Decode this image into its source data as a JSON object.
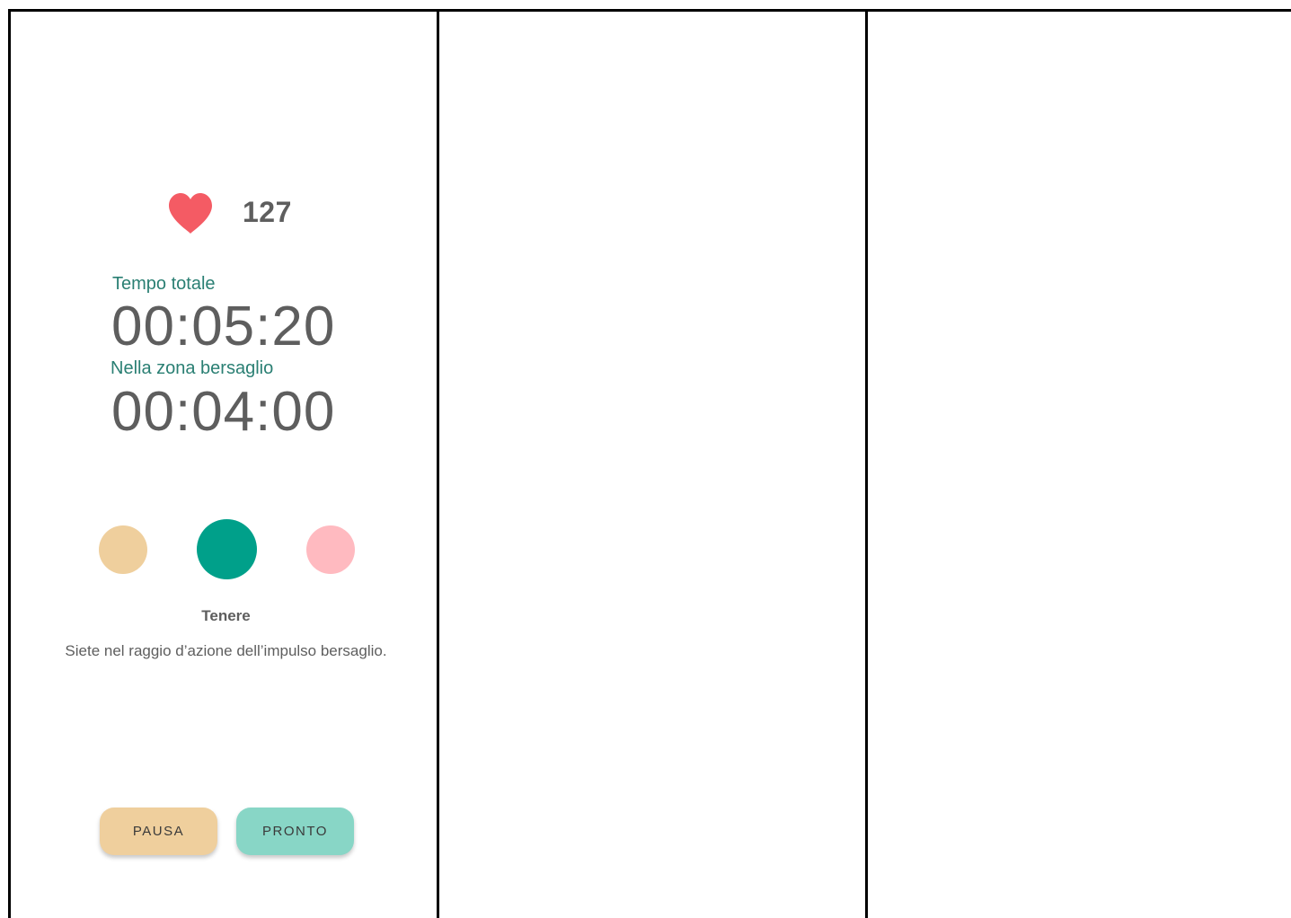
{
  "heart_rate": {
    "icon": "heart-icon",
    "icon_color": "#f45b64",
    "value": "127"
  },
  "timers": {
    "total_label": "Tempo totale",
    "total_value": "00:05:20",
    "zone_label": "Nella zona bersaglio",
    "zone_value": "00:04:00"
  },
  "zone_indicator": {
    "colors": {
      "below": "#efcf9d",
      "in_zone": "#00a08a",
      "above": "#ffbac0"
    },
    "active": "in_zone"
  },
  "status": {
    "title": "Tenere",
    "description": "Siete nel raggio d’azione dell’impulso bersaglio."
  },
  "buttons": {
    "pause_label": "PAUSA",
    "ready_label": "PRONTO"
  }
}
